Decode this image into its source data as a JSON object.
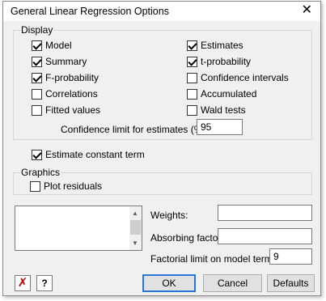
{
  "window": {
    "title": "General Linear Regression Options",
    "close_glyph": "✕"
  },
  "display": {
    "label": "Display",
    "left": [
      {
        "label": "Model",
        "checked": true
      },
      {
        "label": "Summary",
        "checked": true
      },
      {
        "label": "F-probability",
        "checked": true
      },
      {
        "label": "Correlations",
        "checked": false
      },
      {
        "label": "Fitted values",
        "checked": false
      }
    ],
    "right": [
      {
        "label": "Estimates",
        "checked": true
      },
      {
        "label": "t-probability",
        "checked": true
      },
      {
        "label": "Confidence intervals",
        "checked": false
      },
      {
        "label": "Accumulated",
        "checked": false
      },
      {
        "label": "Wald tests",
        "checked": false
      }
    ],
    "confidence_label": "Confidence limit for estimates (%):",
    "confidence_value": "95"
  },
  "estimate_constant": {
    "label": "Estimate constant term",
    "checked": true
  },
  "graphics": {
    "label": "Graphics",
    "plot_residuals": {
      "label": "Plot residuals",
      "checked": false
    }
  },
  "fields": {
    "weights_label": "Weights:",
    "weights_value": "",
    "absorbing_label": "Absorbing factor:",
    "absorbing_value": "",
    "factorial_label": "Factorial limit on model terms:",
    "factorial_value": "9"
  },
  "buttons": {
    "ok": "OK",
    "cancel": "Cancel",
    "defaults": "Defaults",
    "help_glyph": "?",
    "clear_glyph": "✗"
  },
  "colors": {
    "accent": "#2a76d2",
    "clear_icon": "#c00000"
  }
}
